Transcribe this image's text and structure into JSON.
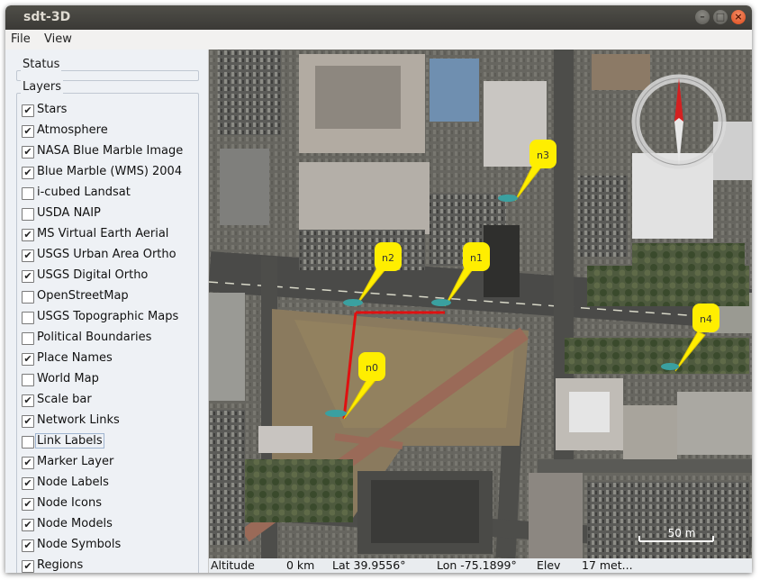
{
  "window": {
    "title": "sdt-3D"
  },
  "menu": {
    "file": "File",
    "view": "View"
  },
  "panel": {
    "status_title": "Status",
    "layers_title": "Layers",
    "layers": [
      {
        "label": "Stars",
        "checked": true
      },
      {
        "label": "Atmosphere",
        "checked": true
      },
      {
        "label": "NASA Blue Marble Image",
        "checked": true
      },
      {
        "label": "Blue Marble (WMS) 2004",
        "checked": true
      },
      {
        "label": "i-cubed Landsat",
        "checked": false
      },
      {
        "label": "USDA NAIP",
        "checked": false
      },
      {
        "label": "MS Virtual Earth Aerial",
        "checked": true
      },
      {
        "label": "USGS Urban Area Ortho",
        "checked": true
      },
      {
        "label": "USGS Digital Ortho",
        "checked": true
      },
      {
        "label": "OpenStreetMap",
        "checked": false
      },
      {
        "label": "USGS Topographic Maps",
        "checked": false
      },
      {
        "label": "Political Boundaries",
        "checked": false
      },
      {
        "label": "Place Names",
        "checked": true
      },
      {
        "label": "World Map",
        "checked": false
      },
      {
        "label": "Scale bar",
        "checked": true
      },
      {
        "label": "Network Links",
        "checked": true
      },
      {
        "label": "Link Labels",
        "checked": false
      },
      {
        "label": "Marker Layer",
        "checked": true
      },
      {
        "label": "Node Labels",
        "checked": true
      },
      {
        "label": "Node Icons",
        "checked": true
      },
      {
        "label": "Node Models",
        "checked": true
      },
      {
        "label": "Node Symbols",
        "checked": true
      },
      {
        "label": "Regions",
        "checked": true
      }
    ]
  },
  "map": {
    "nodes": [
      "n0",
      "n1",
      "n2",
      "n3",
      "n4"
    ],
    "scale_label": "50 m",
    "link_color": "#e01010",
    "marker_color": "#ffee00",
    "compass_needle_color": "#d42020"
  },
  "status": {
    "altitude_label": "Altitude",
    "altitude_value": "0 km",
    "lat": "Lat 39.9556°",
    "lon": "Lon -75.1899°",
    "elev_label": "Elev",
    "elev_value": "17 met..."
  }
}
